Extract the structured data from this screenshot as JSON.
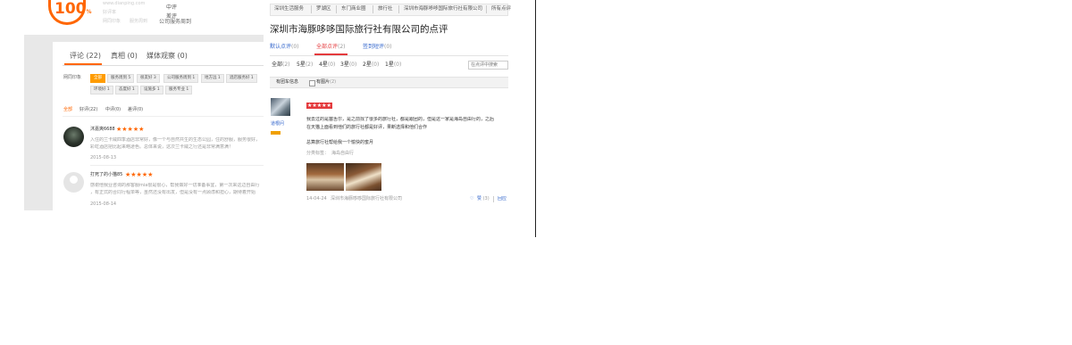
{
  "top_left": {
    "score": "100",
    "score_unit": "%",
    "blurred_line1": "www.dianping.com",
    "blurred_line2": "好评率",
    "blurred_line3": "网同印象",
    "blurred_line4": "服务周到",
    "mid_label": "中评",
    "bad_label": "差评",
    "strip_text": "公司服务周到"
  },
  "left_panel": {
    "tabs": [
      {
        "label": "评论 (22)"
      },
      {
        "label": "真相 (0)"
      },
      {
        "label": "媒体观察 (0)"
      }
    ],
    "impression_label": "网同印象",
    "tags_row1": [
      "全部",
      "服务周到 5",
      "很友好 3",
      "公司服务周到 1",
      "地方远 1",
      "酒店服务好 1"
    ],
    "tags_row2": [
      "环境好 1",
      "态度好 1",
      "设施多 1",
      "服务专业 1"
    ],
    "filters": [
      {
        "label": "全部"
      },
      {
        "label": "好评",
        "count": "(22)"
      },
      {
        "label": "中评",
        "count": "(0)"
      },
      {
        "label": "差评",
        "count": "(0)"
      }
    ],
    "reviews": [
      {
        "user": "沐嘉爽6688",
        "stars": "★★★★★",
        "text1": "入住的兰卡威四季酒店非常好，像一个与自然共生的生态公园，住的舒服，服务很好，",
        "text2": "彩虹酒店把比起来略逊色。总体来说，这次兰卡威之行还是非常满意满！",
        "date": "2015-08-13"
      },
      {
        "user": "打死了的小猫85",
        "stars": "★★★★★",
        "text1": "感谢他我业咨询的那客服mia很是很心，帮我做好一切准备事宜，第一次来这边自由行",
        "text2": "，有正式的合同行程单等，虽然还没有出发，但是没有一点顾虑和担心，期待着开始",
        "date": "2015-08-14"
      }
    ]
  },
  "right_panel": {
    "breadcrumb": [
      "深圳生活服务",
      "罗湖区",
      "东门商业圈",
      "旅行社",
      "深圳市海豚哆哆国际旅行社有限公司",
      "所有点评"
    ],
    "title": "深圳市海豚哆哆国际旅行社有限公司的点评",
    "sub_tabs": [
      {
        "label": "默认点评",
        "count": "(0)"
      },
      {
        "label": "全部点评",
        "count": "(2)"
      },
      {
        "label": "签到短评",
        "count": "(0)"
      }
    ],
    "filters": [
      {
        "label": "全部",
        "count": "(2)"
      },
      {
        "label": "5星",
        "count": "(2)"
      },
      {
        "label": "4星",
        "count": "(0)"
      },
      {
        "label": "3星",
        "count": "(0)"
      },
      {
        "label": "2星",
        "count": "(0)"
      },
      {
        "label": "1星",
        "count": "(0)"
      }
    ],
    "search_placeholder": "在点评中搜索",
    "options": {
      "opt1": "有团车信息",
      "opt2": "有图片",
      "opt2_count": "(2)"
    },
    "review": {
      "username": "道根问",
      "stars": "★★★★★",
      "text1": "我去过的是塞舌尔，是之前找了很多的旅行社，都是跟团的，但是这一家是海岛自由行的，之后",
      "text2": "在天猫上面看到他们的旅行社都是好评，果断选择和他们合作",
      "text3": "总算旅行社帮给我一个愉快的蜜月",
      "tag_label": "分类标签：",
      "tag_value": "海岛自由行",
      "date": "14-04-24",
      "shop": "深圳市海豚哆哆国际旅行社有限公司",
      "like_label": "赞",
      "like_count": "(3)",
      "reply_label": "回应"
    }
  }
}
